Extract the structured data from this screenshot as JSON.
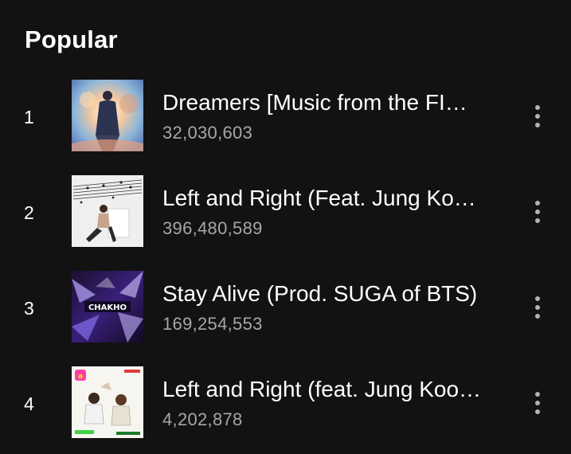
{
  "section": {
    "title": "Popular"
  },
  "tracks": [
    {
      "index": "1",
      "title": "Dreamers [Music from the FI…",
      "plays": "32,030,603"
    },
    {
      "index": "2",
      "title": "Left and Right (Feat. Jung Ko…",
      "plays": "396,480,589"
    },
    {
      "index": "3",
      "title": "Stay Alive (Prod. SUGA of BTS)",
      "plays": "169,254,553",
      "cover_text": "CHAKHO"
    },
    {
      "index": "4",
      "title": "Left and Right (feat. Jung Koo…",
      "plays": "4,202,878"
    }
  ],
  "icons": {
    "more": "more-vertical-icon"
  },
  "colors": {
    "background": "#121212",
    "primary_text": "#ffffff",
    "secondary_text": "#a7a7a7",
    "icon": "#b3b3b3"
  }
}
